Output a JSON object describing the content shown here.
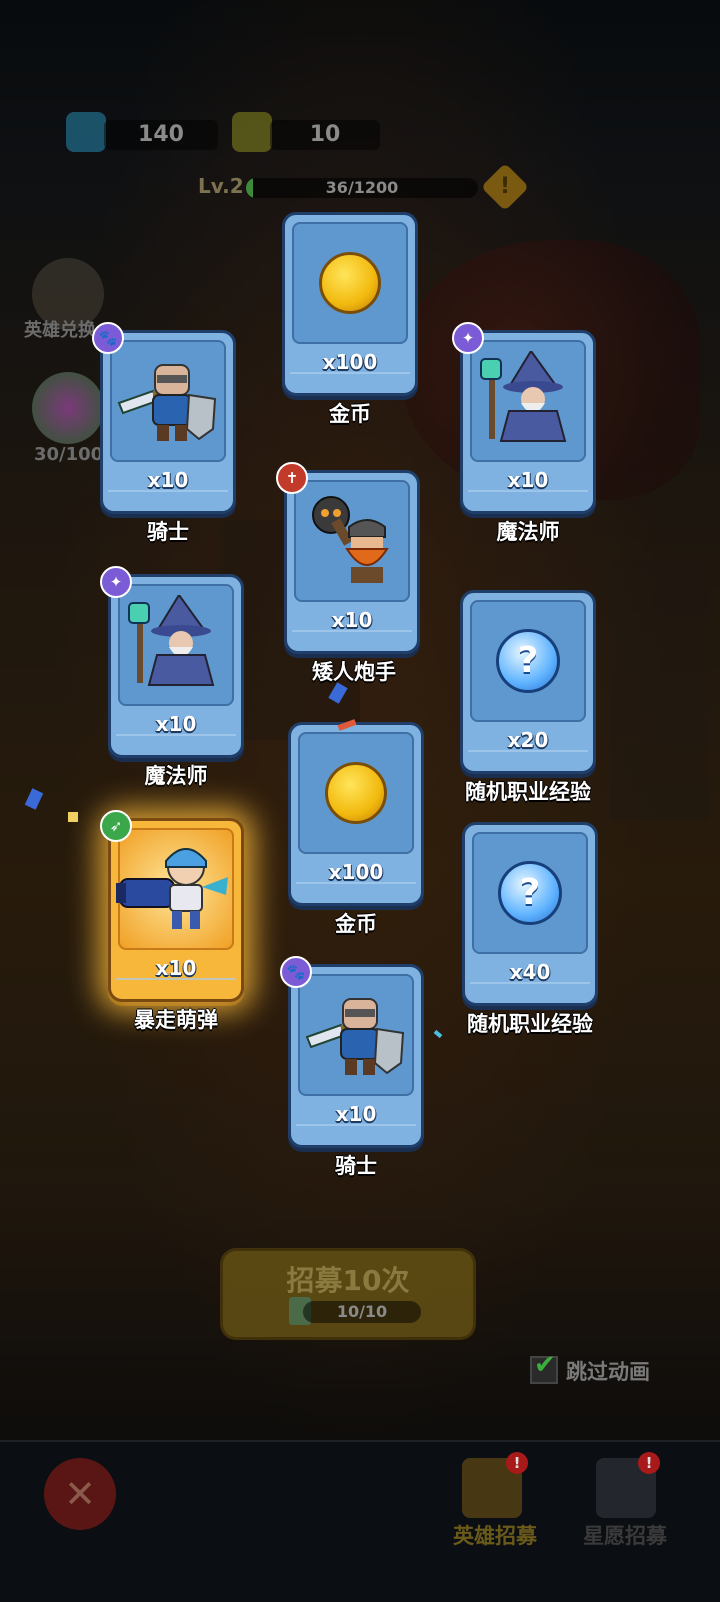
{
  "currency": {
    "gems": "140",
    "tickets": "10"
  },
  "level": {
    "label": "Lv.2",
    "xp_text": "36/1200",
    "xp_progress": 0.03,
    "warn_icon": "!"
  },
  "side": {
    "hero_exchange": "英雄兑换",
    "star_progress": "30/100"
  },
  "cards": [
    {
      "name": "金币",
      "qty": "x100",
      "art": "coin",
      "badge": null
    },
    {
      "name": "骑士",
      "qty": "x10",
      "art": "knight",
      "badge": "paw",
      "badge_color": "#7b5cd6"
    },
    {
      "name": "魔法师",
      "qty": "x10",
      "art": "wizard",
      "badge": "wand",
      "badge_color": "#7b5cd6"
    },
    {
      "name": "矮人炮手",
      "qty": "x10",
      "art": "dwarf",
      "badge": "sword",
      "badge_color": "#c23a2a"
    },
    {
      "name": "魔法师",
      "qty": "x10",
      "art": "wizard",
      "badge": "wand",
      "badge_color": "#7b5cd6"
    },
    {
      "name": "随机职业经验",
      "qty": "x20",
      "art": "question",
      "badge": null
    },
    {
      "name": "金币",
      "qty": "x100",
      "art": "coin",
      "badge": null
    },
    {
      "name": "暴走萌弹",
      "qty": "x10",
      "art": "cannoneer",
      "badge": "bow",
      "badge_color": "#3aa84a"
    },
    {
      "name": "随机职业经验",
      "qty": "x40",
      "art": "question",
      "badge": null
    },
    {
      "name": "骑士",
      "qty": "x10",
      "art": "knight",
      "badge": "paw",
      "badge_color": "#7b5cd6"
    }
  ],
  "recruit": {
    "label": "招募10次",
    "tickets": "10/10"
  },
  "skip": {
    "checked": true,
    "label": "跳过动画"
  },
  "bottom_tabs": [
    {
      "label": "英雄招募",
      "active": true,
      "color": "#6a5a1a",
      "alert": "!"
    },
    {
      "label": "星愿招募",
      "active": false,
      "color": "#3a3a3a",
      "alert": "!"
    }
  ],
  "card_question_mark": "?"
}
